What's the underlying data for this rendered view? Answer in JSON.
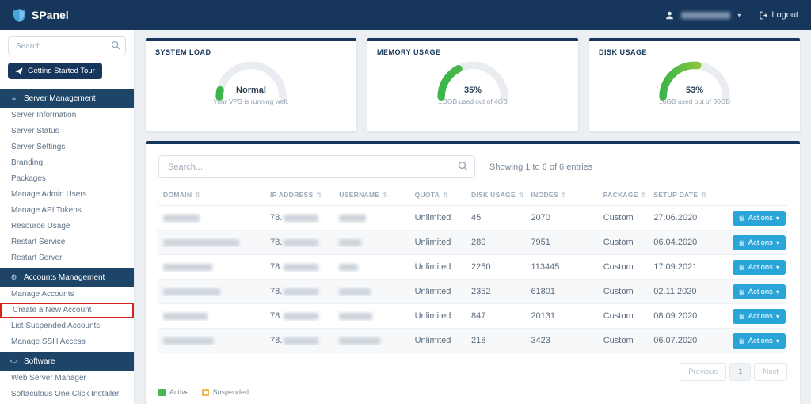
{
  "topbar": {
    "brand": "SPanel",
    "logout_label": "Logout"
  },
  "sidebar": {
    "search_placeholder": "Search...",
    "tour_button": "Getting Started Tour",
    "sections": [
      {
        "label": "Server Management",
        "items": [
          "Server Information",
          "Server Status",
          "Server Settings",
          "Branding",
          "Packages",
          "Manage Admin Users",
          "Manage API Tokens",
          "Resource Usage",
          "Restart Service",
          "Restart Server"
        ]
      },
      {
        "label": "Accounts Management",
        "items": [
          "Manage Accounts",
          "Create a New Account",
          "List Suspended Accounts",
          "Manage SSH Access"
        ]
      },
      {
        "label": "Software",
        "items": [
          "Web Server Manager",
          "Softaculous One Click Installer"
        ]
      }
    ],
    "highlight_color": "#d8231d"
  },
  "gauges": [
    {
      "title": "SYSTEM LOAD",
      "value": "Normal",
      "subtitle": "Your VPS is running well.",
      "percent": 7,
      "color_start": "#3cb54a",
      "color_end": "#3cb54a"
    },
    {
      "title": "MEMORY USAGE",
      "value": "35%",
      "subtitle": "1.3GB used out of 4GB",
      "percent": 35,
      "color_start": "#3cb54a",
      "color_end": "#64c046"
    },
    {
      "title": "DISK USAGE",
      "value": "53%",
      "subtitle": "16GB used out of 30GB",
      "percent": 53,
      "color_start": "#3cb54a",
      "color_end": "#c3d230"
    }
  ],
  "accounts": {
    "search_placeholder": "Search...",
    "showing": "Showing 1 to 6 of 6 entries",
    "columns": [
      "DOMAIN",
      "IP ADDRESS",
      "USERNAME",
      "QUOTA",
      "DISK USAGE",
      "INODES",
      "PACKAGE",
      "SETUP DATE"
    ],
    "actions_label": "Actions",
    "rows": [
      {
        "ip_prefix": "78.",
        "quota": "Unlimited",
        "disk_usage": "45",
        "inodes": "2070",
        "package": "Custom",
        "setup_date": "27.06.2020"
      },
      {
        "ip_prefix": "78.",
        "quota": "Unlimited",
        "disk_usage": "280",
        "inodes": "7951",
        "package": "Custom",
        "setup_date": "06.04.2020"
      },
      {
        "ip_prefix": "78.",
        "quota": "Unlimited",
        "disk_usage": "2250",
        "inodes": "113445",
        "package": "Custom",
        "setup_date": "17.09.2021"
      },
      {
        "ip_prefix": "78.",
        "quota": "Unlimited",
        "disk_usage": "2352",
        "inodes": "61801",
        "package": "Custom",
        "setup_date": "02.11.2020"
      },
      {
        "ip_prefix": "78.",
        "quota": "Unlimited",
        "disk_usage": "847",
        "inodes": "20131",
        "package": "Custom",
        "setup_date": "08.09.2020"
      },
      {
        "ip_prefix": "78.",
        "quota": "Unlimited",
        "disk_usage": "218",
        "inodes": "3423",
        "package": "Custom",
        "setup_date": "06.07.2020"
      }
    ],
    "pagination": {
      "previous": "Previous",
      "page": "1",
      "next": "Next"
    },
    "legend": [
      {
        "label": "Active",
        "color": "#46b656"
      },
      {
        "label": "Suspended",
        "color": "#f0b84f"
      }
    ]
  },
  "colors": {
    "navy": "#17365c",
    "accent_blue": "#2aa5da",
    "gauge_track": "#e9ecf0"
  }
}
